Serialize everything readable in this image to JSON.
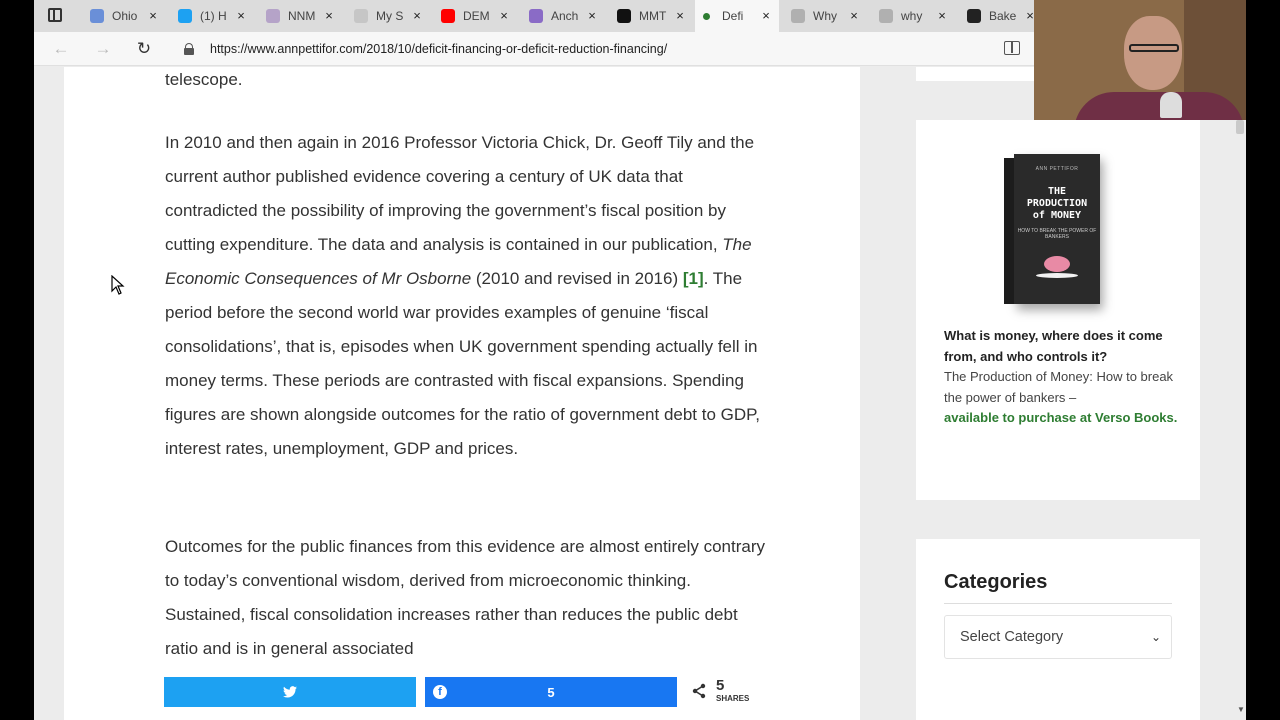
{
  "browser": {
    "tabs": [
      {
        "label": "Ohio",
        "color": "#6a8fd8"
      },
      {
        "label": "(1) H",
        "color": "#1da1f2"
      },
      {
        "label": "NNM",
        "color": "#b5a3c8"
      },
      {
        "label": "My S",
        "color": "#c6c6c6"
      },
      {
        "label": "DEM",
        "color": "#ff0000"
      },
      {
        "label": "Anch",
        "color": "#8a6bc6"
      },
      {
        "label": "MMT",
        "color": "#111111"
      },
      {
        "label": "Defi",
        "color": "#2e7d32"
      },
      {
        "label": "Why",
        "color": "#b0b0b0"
      },
      {
        "label": "why",
        "color": "#b0b0b0"
      },
      {
        "label": "Bake",
        "color": "#222222"
      }
    ],
    "tab_close_glyph": "×",
    "url": "https://www.annpettifor.com/2018/10/deficit-financing-or-deficit-reduction-financing/",
    "back_glyph": "←",
    "forward_glyph": "→",
    "refresh_glyph": "↻"
  },
  "article": {
    "para0": "telescope.",
    "para1": {
      "before_title": "In 2010 and then again in 2016 Professor Victoria Chick, Dr. Geoff Tily and the current author published evidence covering a century of UK data that contradicted the possibility of improving the government’s fiscal position by cutting expenditure. The data and analysis is contained in our publication, ",
      "title": "The Economic Consequences of Mr Osborne",
      "middle": " (2010 and revised in 2016) ",
      "ref": "[1]",
      "after_ref": ". The period before the second world war provides examples of genuine ‘fiscal consolidations’, that is, episodes when UK government spending actually fell in money terms. These periods are contrasted with fiscal expansions. Spending figures are shown alongside outcomes for the ratio of government debt to GDP, interest rates, unemployment, GDP and prices."
    },
    "para2": "Outcomes for the public finances from this evidence are almost entirely contrary to today’s conventional wisdom, derived from microeconomic thinking. Sustained, fiscal consolidation increases rather than reduces the public debt ratio and is in general associated"
  },
  "book_widget": {
    "cover": {
      "author": "ANN PETTIFOR",
      "title_line1": "THE",
      "title_line2": "PRODUCTION",
      "title_line3": "of MONEY",
      "subtitle": "HOW TO BREAK THE POWER OF BANKERS",
      "spine_text": "THE PRODUCTION of MONEY"
    },
    "question": "What is money, where does it come from, and who controls it?",
    "description": "The Production of Money: How to break the power of bankers –",
    "link": "available to purchase at Verso Books."
  },
  "categories": {
    "title": "Categories",
    "select_value": "Select Category"
  },
  "share": {
    "total": "5",
    "label": "SHARES",
    "facebook_count": "5"
  }
}
